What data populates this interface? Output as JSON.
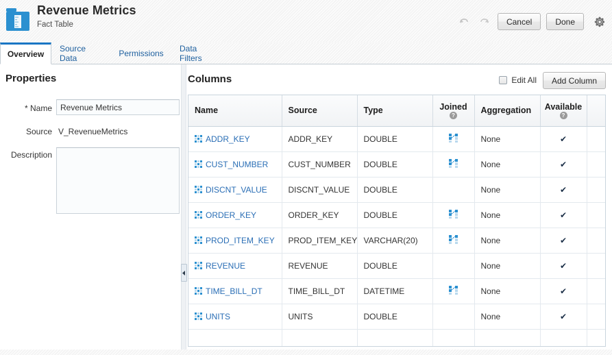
{
  "header": {
    "icon": "fact-table-folder-icon",
    "title": "Revenue Metrics",
    "subtitle": "Fact Table",
    "undo_icon": "undo-icon",
    "redo_icon": "redo-icon",
    "cancel_label": "Cancel",
    "done_label": "Done",
    "settings_icon": "gear-icon"
  },
  "tabs": [
    {
      "label": "Overview",
      "active": true
    },
    {
      "label": "Source Data",
      "active": false
    },
    {
      "label": "Permissions",
      "active": false
    },
    {
      "label": "Data Filters",
      "active": false
    }
  ],
  "properties": {
    "title": "Properties",
    "name_label": "Name",
    "name_required_marker": "*",
    "name_value": "Revenue Metrics",
    "source_label": "Source",
    "source_value": "V_RevenueMetrics",
    "description_label": "Description",
    "description_value": "",
    "splitter_icon": "collapse-left-icon"
  },
  "columns_panel": {
    "title": "Columns",
    "edit_all_label": "Edit All",
    "edit_all_checked": false,
    "add_column_label": "Add Column",
    "table": {
      "headers": [
        {
          "label": "Name",
          "help": false
        },
        {
          "label": "Source",
          "help": false
        },
        {
          "label": "Type",
          "help": false
        },
        {
          "label": "Joined",
          "help": true
        },
        {
          "label": "Aggregation",
          "help": false
        },
        {
          "label": "Available",
          "help": true
        },
        {
          "label": "",
          "help": false
        }
      ],
      "rows": [
        {
          "name": "ADDR_KEY",
          "source": "ADDR_KEY",
          "type": "DOUBLE",
          "joined": true,
          "aggregation": "None",
          "available": true
        },
        {
          "name": "CUST_NUMBER",
          "source": "CUST_NUMBER",
          "type": "DOUBLE",
          "joined": true,
          "aggregation": "None",
          "available": true
        },
        {
          "name": "DISCNT_VALUE",
          "source": "DISCNT_VALUE",
          "type": "DOUBLE",
          "joined": false,
          "aggregation": "None",
          "available": true
        },
        {
          "name": "ORDER_KEY",
          "source": "ORDER_KEY",
          "type": "DOUBLE",
          "joined": true,
          "aggregation": "None",
          "available": true
        },
        {
          "name": "PROD_ITEM_KEY",
          "source": "PROD_ITEM_KEY",
          "type": "VARCHAR(20)",
          "joined": true,
          "aggregation": "None",
          "available": true
        },
        {
          "name": "REVENUE",
          "source": "REVENUE",
          "type": "DOUBLE",
          "joined": false,
          "aggregation": "None",
          "available": true
        },
        {
          "name": "TIME_BILL_DT",
          "source": "TIME_BILL_DT",
          "type": "DATETIME",
          "joined": true,
          "aggregation": "None",
          "available": true
        },
        {
          "name": "UNITS",
          "source": "UNITS",
          "type": "DOUBLE",
          "joined": false,
          "aggregation": "None",
          "available": true
        }
      ],
      "check_glyph": "✔"
    }
  },
  "colors": {
    "accent_blue": "#1a76c4",
    "link_blue": "#2a6eb5",
    "icon_blue": "#2b90d0",
    "icon_blue_light": "#b9d9ee",
    "tab_border": "#c4ccd3",
    "table_border": "#c9d4dd"
  }
}
